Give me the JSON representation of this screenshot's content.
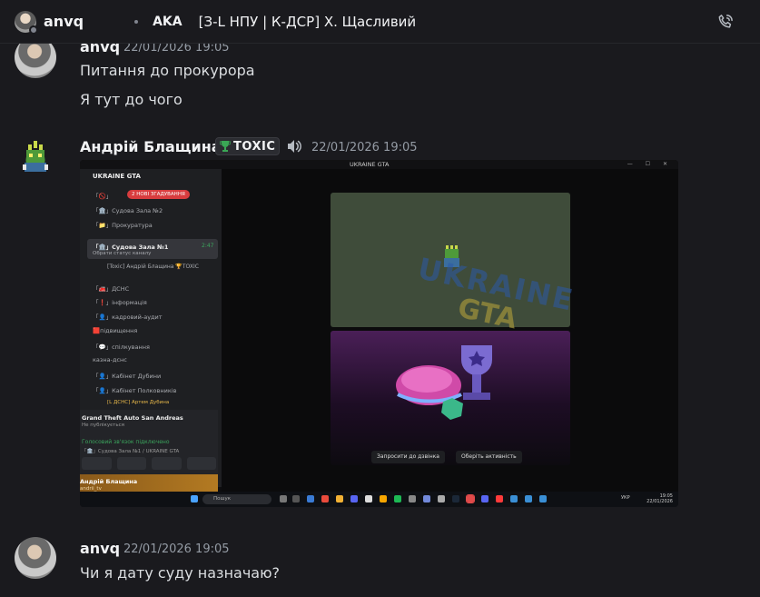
{
  "header": {
    "user_name": "anvq",
    "aka_label": "AKA",
    "nickname": "[З-L НПУ | К-ДСР] Х. Щасливий",
    "call_icon": "phone-call-icon"
  },
  "messages": [
    {
      "author": "anvq",
      "timestamp": "22/01/2026 19:05",
      "lines": [
        "Питання до прокурора",
        "Я тут до чого"
      ]
    },
    {
      "author": "Андрій Блащина",
      "badge": "TOXIC",
      "timestamp": "22/01/2026 19:05"
    },
    {
      "author": "anvq",
      "timestamp": "22/01/2026 19:05",
      "lines": [
        "Чи я дату суду назначаю?"
      ]
    }
  ],
  "screenshot": {
    "window_title": "UKRAINE GTA",
    "window_controls": "— ☐ ✕",
    "server_name": "UKRAINE GTA",
    "new_mentions": "2 НОВІ ЗГАДУВАННЯ",
    "channels": [
      "「🚫」",
      "「🏛️」Судова Зала №2",
      "「📁」Прокуратура",
      "「🏛️」Судова Зала №1",
      "Обрати статус каналу",
      "[Toxic] Андрій Блащина 🏆TOXIC",
      "「🚒」ДСНС",
      "「❗」інформація",
      "「👤」кадровий-аудит",
      "🟥підвищення",
      "「💬」спілкування",
      "казна-дснс",
      "「👤」Кабінет Дубини",
      "「👤」Кабінет Полковників",
      "[L ДСНС] Артем Дубина"
    ],
    "voice_time": "2:47",
    "game_title": "Grand Theft Auto San Andreas",
    "game_sub": "Не публікується",
    "voice_status": "Голосовий зв'язок підключено",
    "voice_location": "「🏛️」Судова Зала №1 / UKRAINE GTA",
    "user_name": "Андрій Блащина",
    "user_sub": "andrii_tv",
    "watermark_top": "UKRAINE",
    "watermark_bottom": "GTA",
    "invite_button": "Запросити до дзвінка",
    "activity_button": "Оберіть активність",
    "taskbar_search": "Пошук",
    "clock_time": "19:05",
    "clock_date": "22/01/2026",
    "lang": "УКР"
  }
}
